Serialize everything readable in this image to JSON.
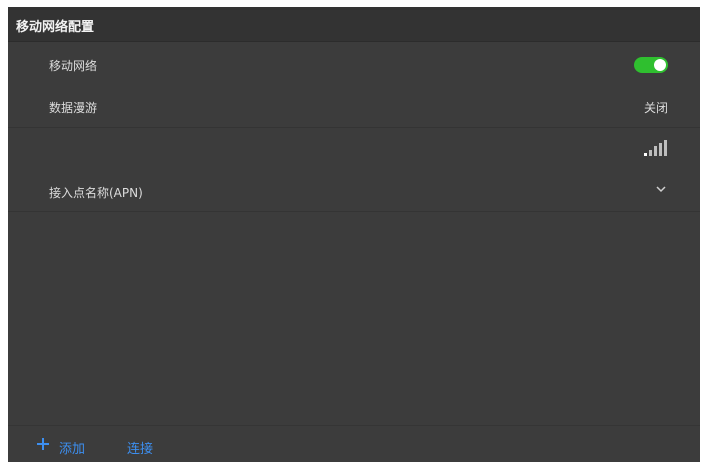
{
  "header": {
    "title": "移动网络配置"
  },
  "rows": {
    "mobile_network": {
      "label": "移动网络",
      "toggle_on": true,
      "toggle_color": "#2fbf2f"
    },
    "roaming": {
      "label": "数据漫游",
      "value": "关闭"
    },
    "signal": {
      "icon": "signal-strength-icon"
    },
    "apn": {
      "label": "接入点名称(APN)",
      "icon": "chevron-down-icon"
    }
  },
  "footer": {
    "add_label": "添加",
    "add_icon": "plus-icon",
    "connect_label": "连接",
    "accent": "#3d8ff0"
  }
}
